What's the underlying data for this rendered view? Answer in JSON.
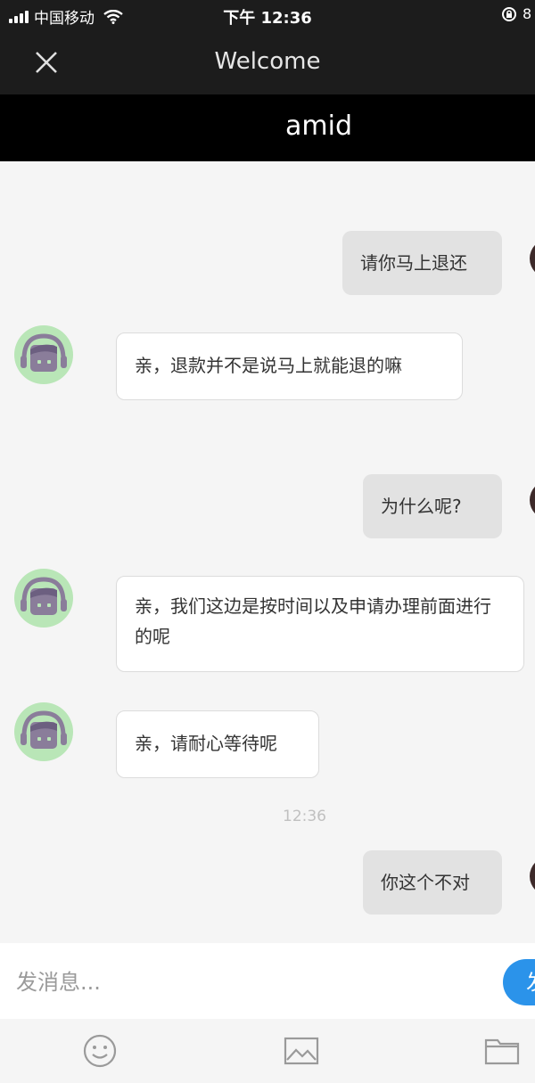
{
  "status_bar": {
    "carrier": "中国移动",
    "time": "下午 12:36",
    "battery_text": "8"
  },
  "header": {
    "title": "Welcome",
    "subtitle": "amid"
  },
  "messages": [
    {
      "side": "right",
      "text": "请你马上退还"
    },
    {
      "side": "left",
      "text": "亲，退款并不是说马上就能退的嘛"
    },
    {
      "side": "right",
      "text": "为什么呢?"
    },
    {
      "side": "left",
      "text": "亲，我们这边是按时间以及申请办理前面进行的呢"
    },
    {
      "side": "left",
      "text": "亲，请耐心等待呢"
    },
    {
      "side": "right",
      "text": "你这个不对"
    }
  ],
  "timestamp": "12:36",
  "input": {
    "placeholder": "发消息...",
    "value": "",
    "send_label": "发送"
  },
  "toolbar": {
    "icons": [
      "emoji-icon",
      "image-icon",
      "folder-icon"
    ]
  },
  "colors": {
    "bar_dark": "#1c1c1c",
    "subheader": "#000000",
    "send_blue": "#2b93ea",
    "avatar_bg": "#b9e6b7",
    "avatar_fg": "#8a7d9a"
  }
}
